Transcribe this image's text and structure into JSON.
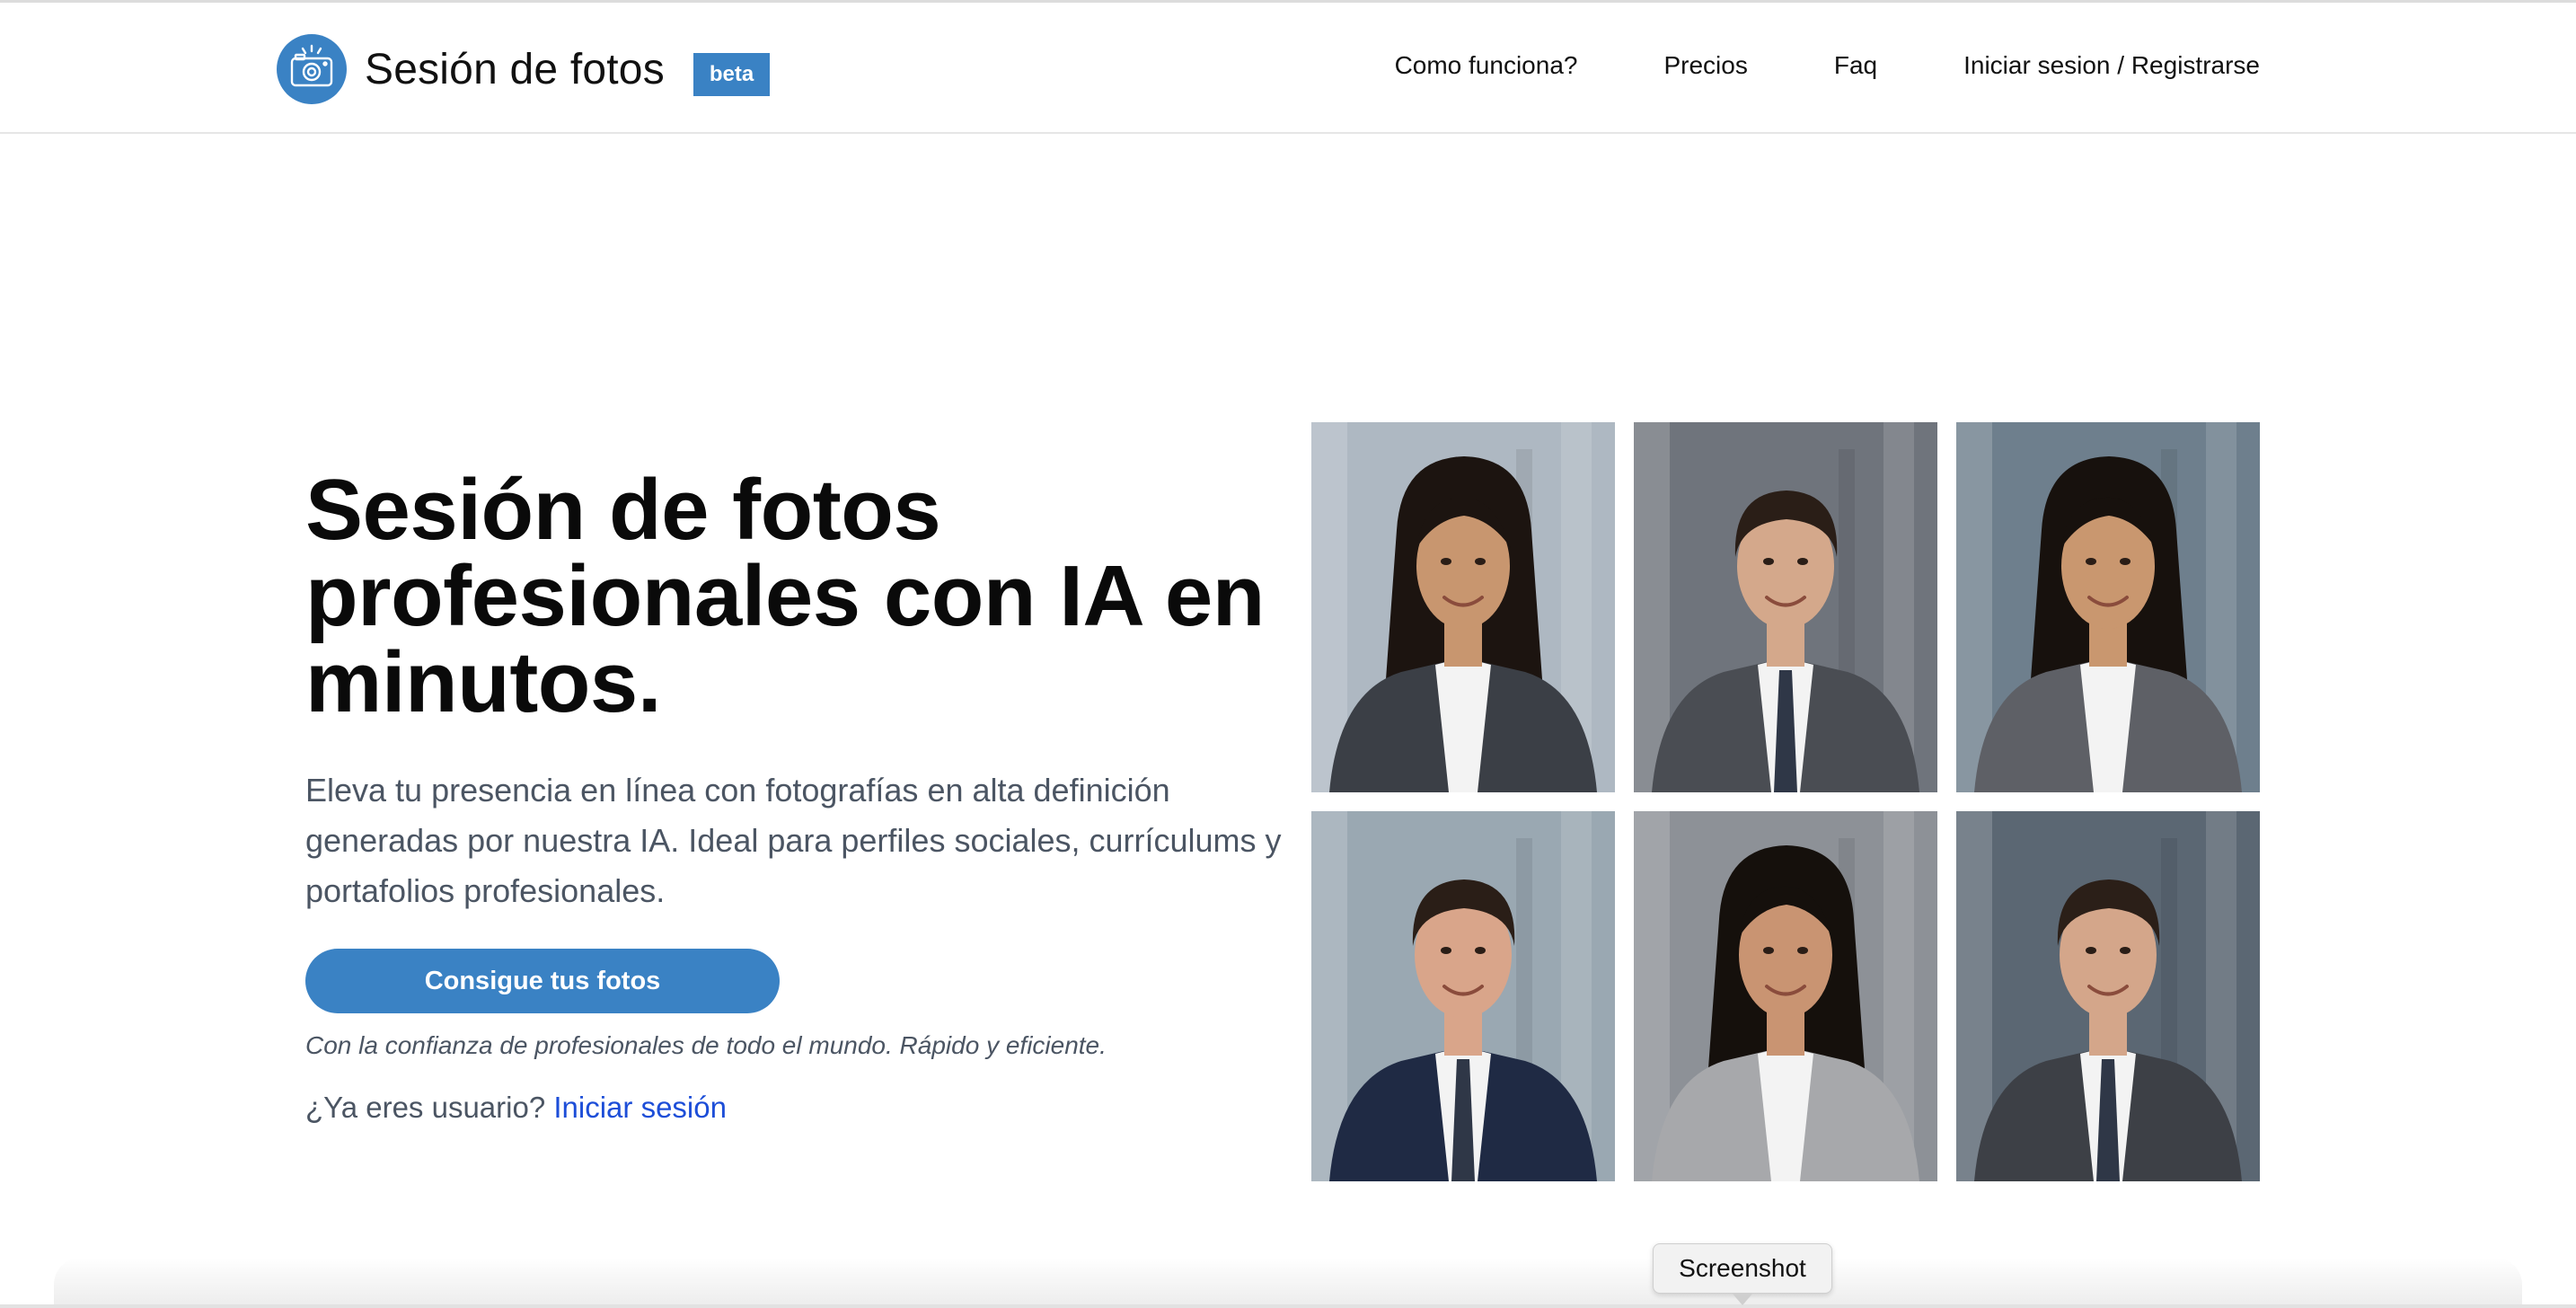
{
  "header": {
    "brand": "Sesión de fotos",
    "badge": "beta",
    "logo_icon": "camera-icon",
    "nav": [
      {
        "label": "Como funciona?"
      },
      {
        "label": "Precios"
      },
      {
        "label": "Faq"
      },
      {
        "label": "Iniciar sesion / Registrarse"
      }
    ]
  },
  "hero": {
    "title_lines": [
      "Sesión de fotos",
      "profesionales con IA en",
      "minutos."
    ],
    "subtitle": "Eleva tu presencia en línea con fotografías en alta definición generadas por nuestra IA. Ideal para perfiles sociales, currículums y portafolios profesionales.",
    "cta_label": "Consigue tus fotos",
    "trust_text": "Con la confianza de profesionales de todo el mundo. Rápido y eficiente.",
    "login_prompt": "¿Ya eres usuario?",
    "login_link": "Iniciar sesión"
  },
  "gallery": {
    "photos": [
      {
        "subject": "woman",
        "bg": "#aeb8c2",
        "suit": "#3b3f46",
        "hair": "#1c1410",
        "skin": "#c8966f"
      },
      {
        "subject": "man",
        "bg": "#6f747c",
        "suit": "#4a4d53",
        "hair": "#2a1e17",
        "skin": "#d4a88b"
      },
      {
        "subject": "woman",
        "bg": "#6e7f8d",
        "suit": "#5e6066",
        "hair": "#17110d",
        "skin": "#c9976f"
      },
      {
        "subject": "man",
        "bg": "#9aa8b2",
        "suit": "#1f2a44",
        "hair": "#2a1e17",
        "skin": "#d9a58a"
      },
      {
        "subject": "woman",
        "bg": "#8d9197",
        "suit": "#a7a8ab",
        "hair": "#15100c",
        "skin": "#c99472"
      },
      {
        "subject": "man",
        "bg": "#5b6773",
        "suit": "#3d4046",
        "hair": "#2b1f18",
        "skin": "#d4a68a"
      }
    ]
  },
  "tooltip": {
    "label": "Screenshot"
  },
  "colors": {
    "accent": "#3a82c4",
    "link": "#1d4ed8",
    "muted_text": "#4b5563"
  }
}
